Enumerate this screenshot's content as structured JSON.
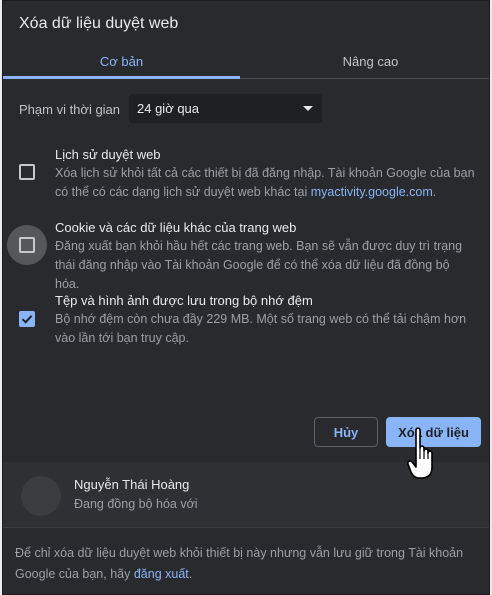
{
  "dialog": {
    "title": "Xóa dữ liệu duyệt web"
  },
  "tabs": [
    {
      "label": "Cơ bản",
      "active": true
    },
    {
      "label": "Nâng cao",
      "active": false
    }
  ],
  "time_range": {
    "label": "Phạm vi thời gian",
    "selected": "24 giờ qua"
  },
  "options": [
    {
      "title": "Lịch sử duyệt web",
      "desc_prefix": "Xóa lịch sử khỏi tất cả các thiết bị đã đăng nhập. Tài khoản Google của bạn có thể có các dạng lịch sử duyệt web khác tại ",
      "desc_link": "myactivity.google.com",
      "desc_suffix": ".",
      "checked": false
    },
    {
      "title": "Cookie và các dữ liệu khác của trang web",
      "desc": "Đăng xuất bạn khỏi hầu hết các trang web. Bạn sẽ vẫn được duy trì trạng thái đăng nhập vào Tài khoản Google để có thể xóa dữ liệu đã đồng bộ hóa.",
      "checked": false
    },
    {
      "title": "Tệp và hình ảnh được lưu trong bộ nhớ đệm",
      "desc": "Bộ nhớ đệm còn chưa đầy 229 MB. Một số trang web có thể tải chậm hơn vào lần tới bạn truy cập.",
      "checked": true
    }
  ],
  "buttons": {
    "cancel": "Hủy",
    "clear": "Xóa dữ liệu"
  },
  "account": {
    "name": "Nguyễn Thái Hoàng",
    "status": "Đang đồng bộ hóa với"
  },
  "footer": {
    "text": "Để chỉ xóa dữ liệu duyệt web khỏi thiết bị này nhưng vẫn lưu giữ trong Tài khoản Google của bạn, hãy ",
    "link": "đăng xuất",
    "suffix": "."
  },
  "colors": {
    "accent": "#8ab4f8",
    "background": "#292a2d"
  },
  "icons": [
    "caret-down-icon",
    "checkmark-icon",
    "hand-pointer-icon"
  ]
}
